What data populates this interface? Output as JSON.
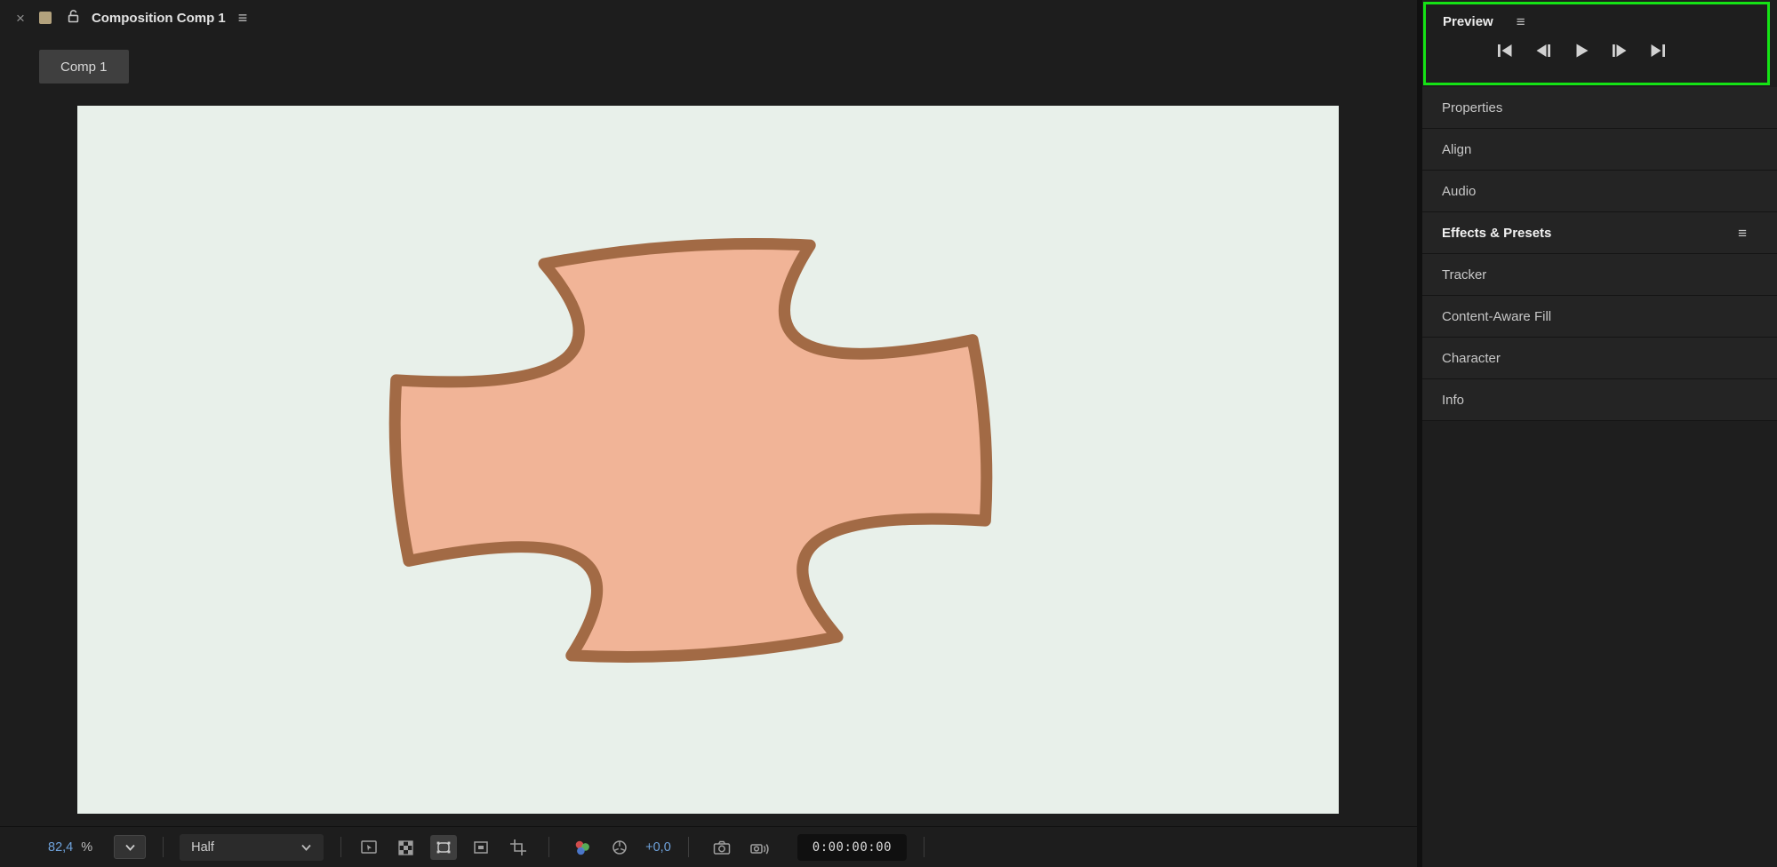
{
  "composition": {
    "title": "Composition Comp 1",
    "tab_label": "Comp 1"
  },
  "viewer_toolbar": {
    "zoom_value": "82,4",
    "zoom_unit": "%",
    "resolution": "Half",
    "exposure": "+0,0",
    "timecode": "0:00:00:00"
  },
  "preview": {
    "title": "Preview",
    "transport_icons": [
      "first-frame-icon",
      "previous-frame-icon",
      "play-icon",
      "next-frame-icon",
      "last-frame-icon"
    ]
  },
  "panels": {
    "items": [
      {
        "label": "Properties"
      },
      {
        "label": "Align"
      },
      {
        "label": "Audio"
      },
      {
        "label": "Effects & Presets"
      },
      {
        "label": "Tracker"
      },
      {
        "label": "Content-Aware Fill"
      },
      {
        "label": "Character"
      },
      {
        "label": "Info"
      }
    ]
  },
  "canvas": {
    "background": "#e8f0ea",
    "shape_fill": "#f1b497",
    "shape_stroke": "#a26a45"
  },
  "colors": {
    "selection_green": "#15e215",
    "value_blue": "#6fa3dc",
    "tab_swatch_tan": "#b3a27d"
  }
}
